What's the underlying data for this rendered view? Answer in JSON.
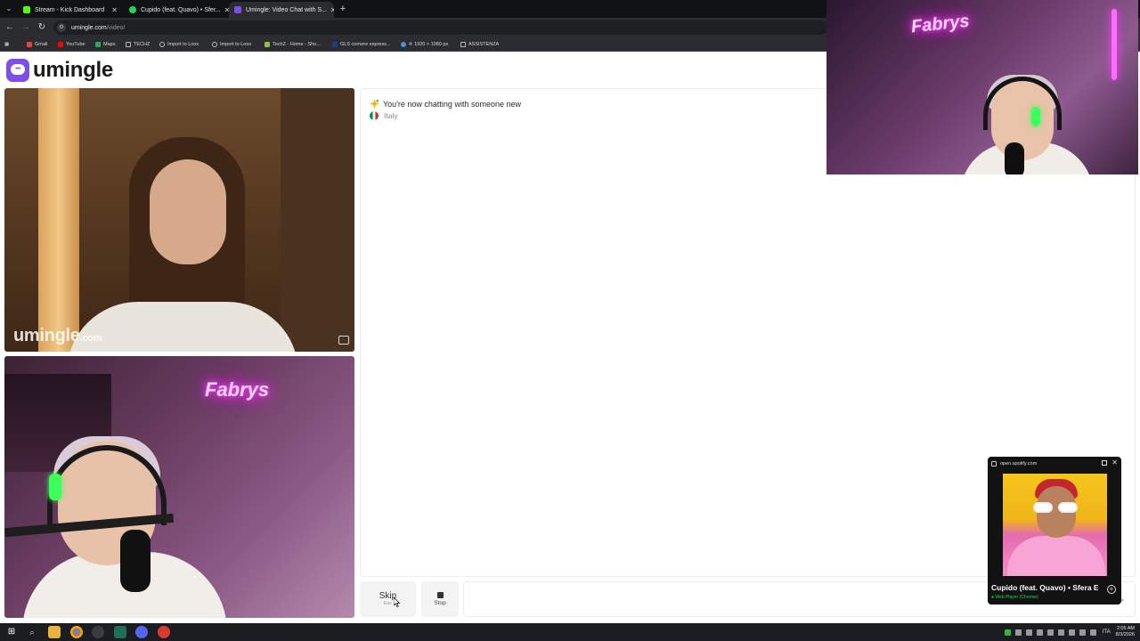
{
  "browser": {
    "tabs": [
      {
        "label": "Stream - Kick Dashboard",
        "icon": "kick-icon",
        "color": "#53fc18",
        "active": false
      },
      {
        "label": "Cupido (feat. Quavo) • Sfer...",
        "icon": "spotify-icon",
        "color": "#1ed760",
        "active": false
      },
      {
        "label": "Umingle: Video Chat with S...",
        "icon": "umingle-icon",
        "color": "#7b4fe8",
        "active": true
      }
    ],
    "url_host": "umingle.com",
    "url_path": "/video/",
    "bookmarks": [
      {
        "label": "Gmail",
        "icon": "gmail-icon",
        "color": "#ea4335"
      },
      {
        "label": "YouTube",
        "icon": "youtube-icon",
        "color": "#ff0000"
      },
      {
        "label": "Maps",
        "icon": "maps-icon",
        "color": "#34a853"
      },
      {
        "label": "TECHZ",
        "icon": "folder-icon",
        "color": "#bdbdbd"
      },
      {
        "label": "Import to Loox",
        "icon": "globe-icon",
        "color": "#bdbdbd"
      },
      {
        "label": "Import to Loox",
        "icon": "globe-icon",
        "color": "#bdbdbd"
      },
      {
        "label": "TechZ - Home - Sho...",
        "icon": "shopify-icon",
        "color": "#95bf47"
      },
      {
        "label": "GLS corriere espress...",
        "icon": "gls-icon",
        "color": "#1b3d8f"
      },
      {
        "label": "4: 1920 × 1080 px",
        "icon": "resolution-icon",
        "color": "#4a90e2"
      },
      {
        "label": "ASSISTENZA",
        "icon": "folder-icon",
        "color": "#bdbdbd"
      }
    ]
  },
  "app": {
    "logo_text": "umingle",
    "accent": "#7b4fe8",
    "watermark_main": "umingle",
    "watermark_suffix": ".com"
  },
  "chat": {
    "status_message": "You're now chatting with someone new",
    "country": "Italy"
  },
  "controls": {
    "skip_label": "Skip",
    "skip_hint": "Esc",
    "stop_label": "Stop",
    "message_placeholder": ""
  },
  "overlay": {
    "neon_text": "Fabrys"
  },
  "mini_player": {
    "site": "open.spotify.com",
    "title": "Cupido (feat. Quavo) • Sfera Ebbasta",
    "device": "Web Player (Chrome)",
    "accent": "#1ed760"
  },
  "taskbar": {
    "lang": "ITA",
    "time": "2:05 AM",
    "date": "8/3/2026"
  }
}
